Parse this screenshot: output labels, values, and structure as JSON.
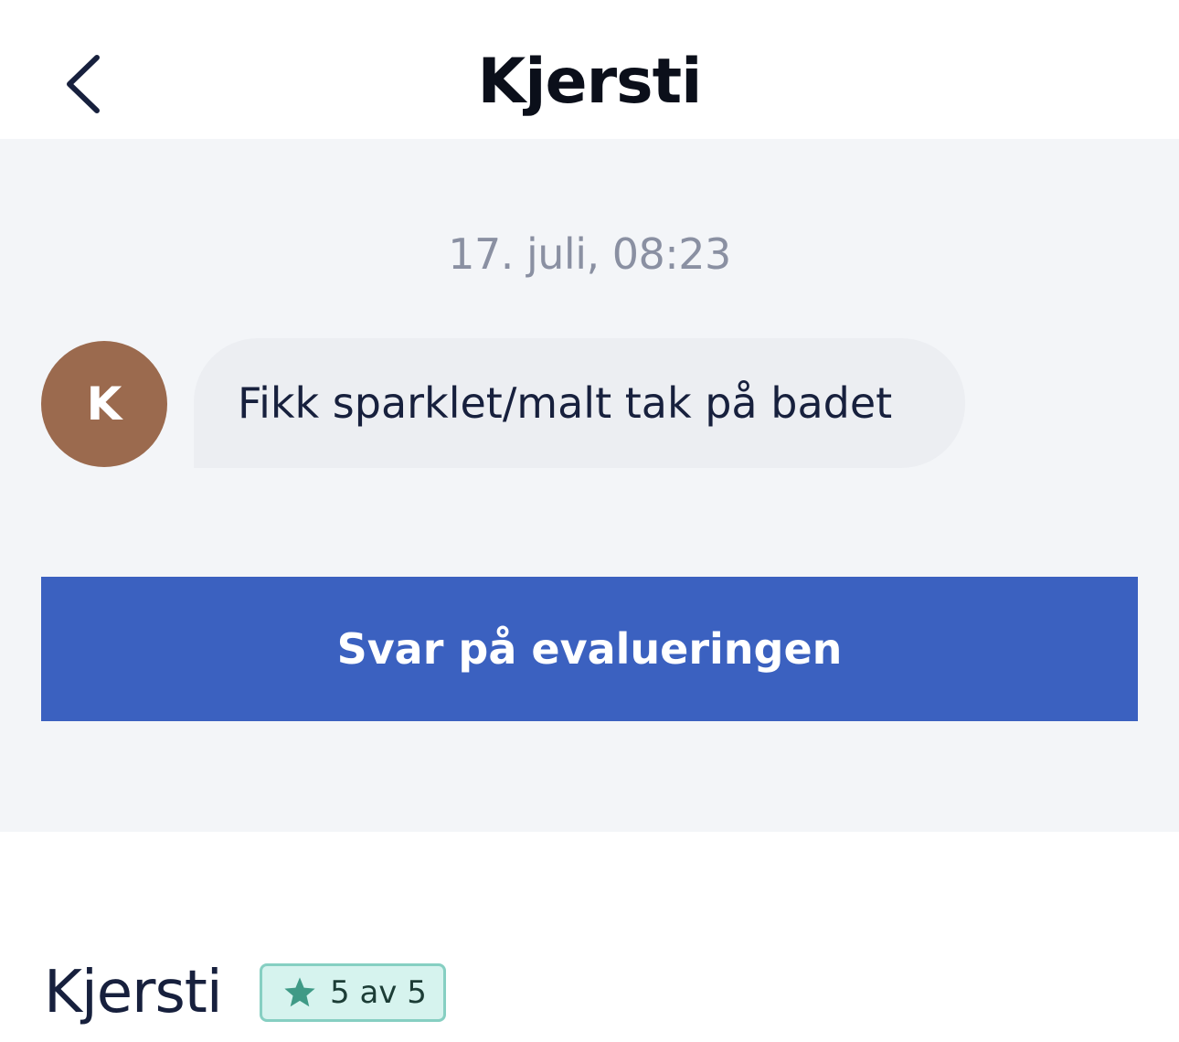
{
  "header": {
    "title": "Kjersti",
    "back_icon": "chevron-left-icon"
  },
  "thread": {
    "timestamp": "17. juli, 08:23",
    "message": {
      "avatar_initial": "K",
      "avatar_color": "#9b6a4e",
      "text": "Fikk sparklet/malt tak på badet"
    },
    "reply_button_label": "Svar på evalueringen",
    "accent_color": "#3b61c0"
  },
  "review": {
    "name": "Kjersti",
    "rating_text": "5 av 5",
    "rating_icon": "star-icon",
    "rating_value": 5,
    "rating_max": 5
  }
}
